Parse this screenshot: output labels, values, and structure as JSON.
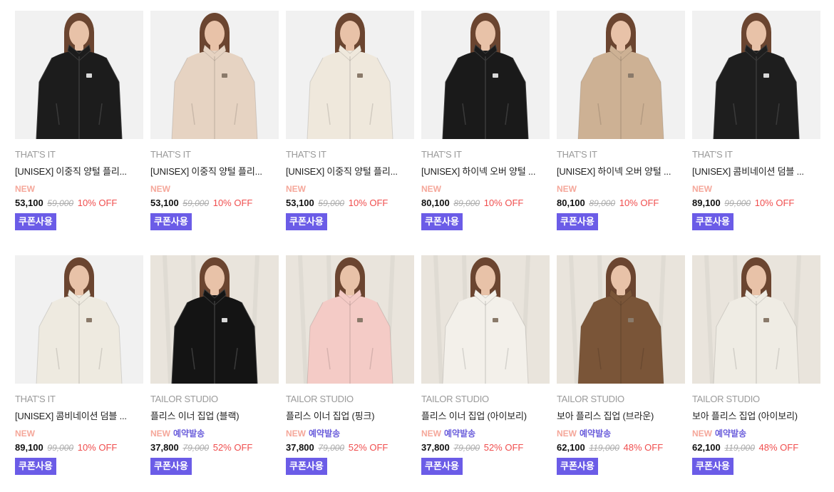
{
  "products": [
    {
      "brand": "THAT'S IT",
      "name": "[UNISEX] 이중직 양털 플리...",
      "new": "NEW",
      "preorder": "",
      "price": "53,100",
      "original": "59,000",
      "discount": "10% OFF",
      "coupon": "쿠폰사용",
      "jacket_color": "#1c1c1c",
      "bg": "#f1f1f1"
    },
    {
      "brand": "THAT'S IT",
      "name": "[UNISEX] 이중직 양털 플리...",
      "new": "NEW",
      "preorder": "",
      "price": "53,100",
      "original": "59,000",
      "discount": "10% OFF",
      "coupon": "쿠폰사용",
      "jacket_color": "#e6d3c2",
      "bg": "#f1f1f1"
    },
    {
      "brand": "THAT'S IT",
      "name": "[UNISEX] 이중직 양털 플리...",
      "new": "NEW",
      "preorder": "",
      "price": "53,100",
      "original": "59,000",
      "discount": "10% OFF",
      "coupon": "쿠폰사용",
      "jacket_color": "#efe8dc",
      "bg": "#f1f1f1"
    },
    {
      "brand": "THAT'S IT",
      "name": "[UNISEX] 하이넥 오버 양털 ...",
      "new": "NEW",
      "preorder": "",
      "price": "80,100",
      "original": "89,000",
      "discount": "10% OFF",
      "coupon": "쿠폰사용",
      "jacket_color": "#1a1a1a",
      "bg": "#f1f1f1"
    },
    {
      "brand": "THAT'S IT",
      "name": "[UNISEX] 하이넥 오버 양털 ...",
      "new": "NEW",
      "preorder": "",
      "price": "80,100",
      "original": "89,000",
      "discount": "10% OFF",
      "coupon": "쿠폰사용",
      "jacket_color": "#cdb194",
      "bg": "#f1f1f1"
    },
    {
      "brand": "THAT'S IT",
      "name": "[UNISEX] 콤비네이션 덤블 ...",
      "new": "NEW",
      "preorder": "",
      "price": "89,100",
      "original": "99,000",
      "discount": "10% OFF",
      "coupon": "쿠폰사용",
      "jacket_color": "#1e1e1e",
      "bg": "#f1f1f1"
    },
    {
      "brand": "THAT'S IT",
      "name": "[UNISEX] 콤비네이션 덤블 ...",
      "new": "NEW",
      "preorder": "",
      "price": "89,100",
      "original": "99,000",
      "discount": "10% OFF",
      "coupon": "쿠폰사용",
      "jacket_color": "#eeeae0",
      "bg": "#f1f1f1"
    },
    {
      "brand": "TAILOR STUDIO",
      "name": "플리스 이너 집업 (블랙)",
      "new": "NEW",
      "preorder": "예약발송",
      "price": "37,800",
      "original": "79,000",
      "discount": "52% OFF",
      "coupon": "쿠폰사용",
      "jacket_color": "#141414",
      "bg": "#e9e4dc"
    },
    {
      "brand": "TAILOR STUDIO",
      "name": "플리스 이너 집업 (핑크)",
      "new": "NEW",
      "preorder": "예약발송",
      "price": "37,800",
      "original": "79,000",
      "discount": "52% OFF",
      "coupon": "쿠폰사용",
      "jacket_color": "#f4cbc6",
      "bg": "#e9e4dc"
    },
    {
      "brand": "TAILOR STUDIO",
      "name": "플리스 이너 집업 (아이보리)",
      "new": "NEW",
      "preorder": "예약발송",
      "price": "37,800",
      "original": "79,000",
      "discount": "52% OFF",
      "coupon": "쿠폰사용",
      "jacket_color": "#f3f0ea",
      "bg": "#e9e4dc"
    },
    {
      "brand": "TAILOR STUDIO",
      "name": "보아 플리스 집업 (브라운)",
      "new": "NEW",
      "preorder": "예약발송",
      "price": "62,100",
      "original": "119,000",
      "discount": "48% OFF",
      "coupon": "쿠폰사용",
      "jacket_color": "#7a5538",
      "bg": "#e9e4dc"
    },
    {
      "brand": "TAILOR STUDIO",
      "name": "보아 플리스 집업 (아이보리)",
      "new": "NEW",
      "preorder": "예약발송",
      "price": "62,100",
      "original": "119,000",
      "discount": "48% OFF",
      "coupon": "쿠폰사용",
      "jacket_color": "#efece4",
      "bg": "#e9e4dc"
    }
  ],
  "colors": {
    "coupon_bg": "#6b5ce7",
    "new_tag": "#f5a79a",
    "preorder_tag": "#6a5ddb",
    "discount": "#f04e4e"
  }
}
